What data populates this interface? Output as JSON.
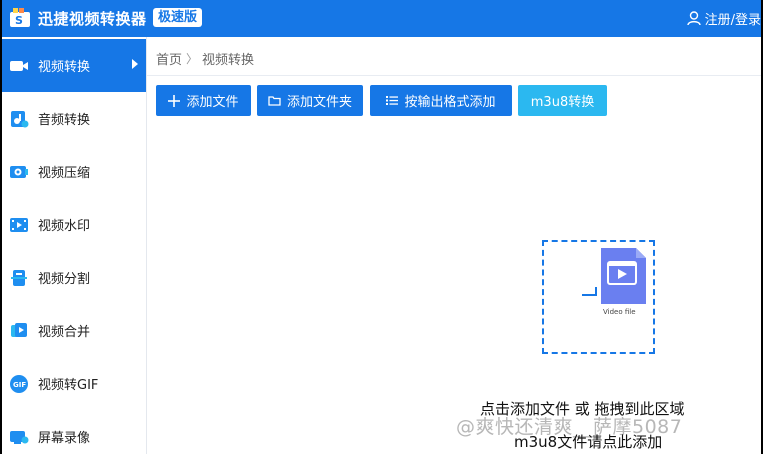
{
  "app": {
    "title": "迅捷视频转换器",
    "edition": "极速版",
    "login": "注册/登录"
  },
  "sidebar": {
    "items": [
      {
        "label": "视频转换",
        "icon": "video-camera-icon",
        "active": true
      },
      {
        "label": "音频转换",
        "icon": "audio-convert-icon",
        "active": false
      },
      {
        "label": "视频压缩",
        "icon": "video-compress-icon",
        "active": false
      },
      {
        "label": "视频水印",
        "icon": "video-watermark-icon",
        "active": false
      },
      {
        "label": "视频分割",
        "icon": "video-split-icon",
        "active": false
      },
      {
        "label": "视频合并",
        "icon": "video-merge-icon",
        "active": false
      },
      {
        "label": "视频转GIF",
        "icon": "gif-icon",
        "active": false
      },
      {
        "label": "屏幕录像",
        "icon": "screen-record-icon",
        "active": false
      }
    ]
  },
  "breadcrumb": {
    "home": "首页",
    "separator": "〉",
    "current": "视频转换"
  },
  "toolbar": {
    "add_file": "添加文件",
    "add_folder": "添加文件夹",
    "add_by_format": "按输出格式添加",
    "m3u8": "m3u8转换"
  },
  "dropzone": {
    "file_label": "Video file",
    "hint_line1": "点击添加文件 或 拖拽到此区域",
    "hint_line2": "m3u8文件请点此添加"
  },
  "watermark": "@爽快还清爽__萨摩5087",
  "colors": {
    "accent": "#1677e6",
    "accent_light": "#2bb8f0",
    "file_icon": "#6a7ff0"
  }
}
